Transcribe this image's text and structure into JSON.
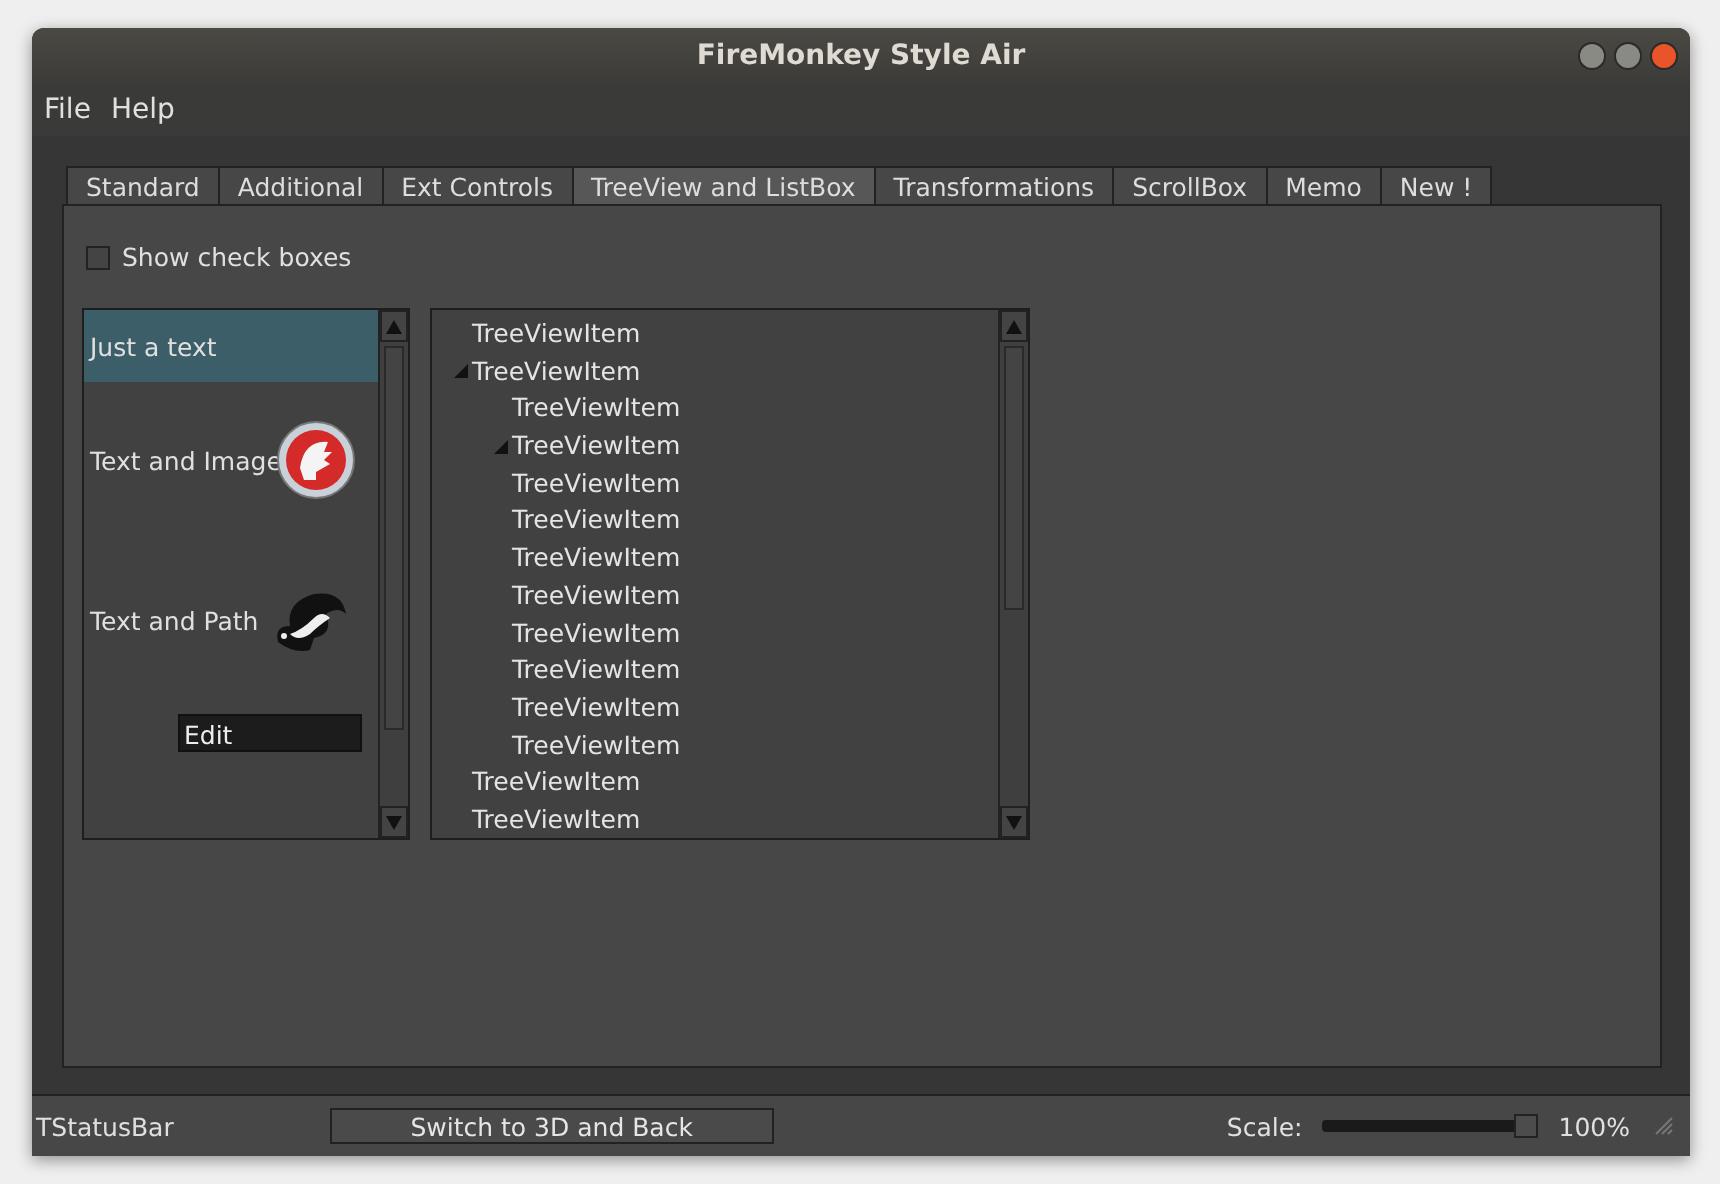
{
  "window": {
    "title": "FireMonkey Style Air"
  },
  "menu": [
    "File",
    "Help"
  ],
  "tabs": [
    {
      "label": "Standard",
      "selected": false
    },
    {
      "label": "Additional",
      "selected": false
    },
    {
      "label": "Ext Controls",
      "selected": false
    },
    {
      "label": "TreeView and ListBox",
      "selected": true
    },
    {
      "label": "Transformations",
      "selected": false
    },
    {
      "label": "ScrollBox",
      "selected": false
    },
    {
      "label": "Memo",
      "selected": false
    },
    {
      "label": "New !",
      "selected": false
    }
  ],
  "show_check_boxes": {
    "label": "Show check boxes",
    "checked": false
  },
  "listbox": {
    "items": [
      {
        "kind": "text",
        "label": "Just a text",
        "selected": true
      },
      {
        "kind": "image",
        "label": "Text and Image",
        "selected": false
      },
      {
        "kind": "path",
        "label": "Text and Path",
        "selected": false
      },
      {
        "kind": "edit",
        "value": "Edit",
        "selected": false
      }
    ]
  },
  "tree": [
    {
      "label": "TreeViewItem",
      "expanded": false
    },
    {
      "label": "TreeViewItem",
      "expanded": true,
      "children": [
        {
          "label": "TreeViewItem",
          "expanded": false
        },
        {
          "label": "TreeViewItem",
          "expanded": true
        },
        {
          "label": "TreeViewItem",
          "expanded": false
        },
        {
          "label": "TreeViewItem",
          "expanded": false
        },
        {
          "label": "TreeViewItem",
          "expanded": false
        },
        {
          "label": "TreeViewItem",
          "expanded": false
        },
        {
          "label": "TreeViewItem",
          "expanded": false
        },
        {
          "label": "TreeViewItem",
          "expanded": false
        },
        {
          "label": "TreeViewItem",
          "expanded": false
        },
        {
          "label": "TreeViewItem",
          "expanded": false
        }
      ]
    },
    {
      "label": "TreeViewItem",
      "expanded": false
    },
    {
      "label": "TreeViewItem",
      "expanded": false
    }
  ],
  "status_bar": {
    "text": "TStatusBar",
    "button": "Switch to 3D and Back",
    "scale_label": "Scale:",
    "scale": {
      "level": 1
    },
    "scale_reading": "100%"
  }
}
